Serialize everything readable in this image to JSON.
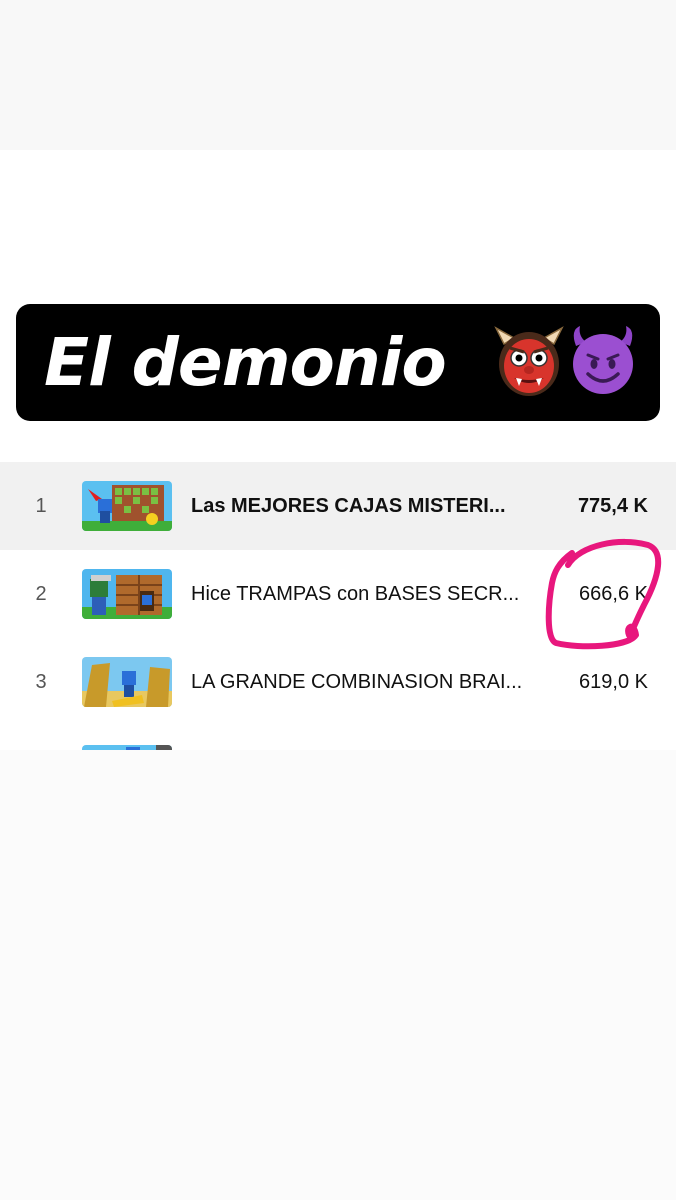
{
  "caption": {
    "text": "El demonio",
    "emojis": [
      "japanese-ogre-emoji",
      "smiling-face-with-horns-emoji"
    ]
  },
  "videos": [
    {
      "rank": "1",
      "title": "Las MEJORES CAJAS MISTERI...",
      "views": "775,4 K",
      "highlighted": true
    },
    {
      "rank": "2",
      "title": "Hice TRAMPAS con BASES SECR...",
      "views": "666,6 K"
    },
    {
      "rank": "3",
      "title": "LA GRANDE COMBINASION BRAI...",
      "views": "619,0 K"
    }
  ],
  "annotation": {
    "color": "#e8177d",
    "shape": "hand-drawn circle around 666,6 K"
  }
}
